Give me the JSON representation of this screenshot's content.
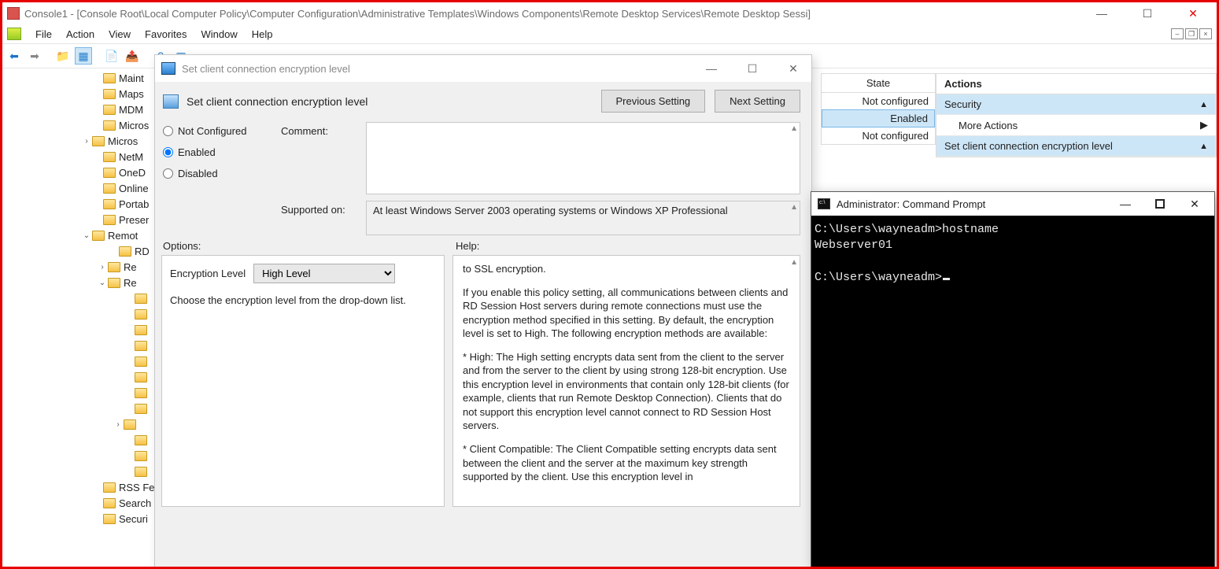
{
  "mmc": {
    "title": "Console1 - [Console Root\\Local Computer Policy\\Computer Configuration\\Administrative Templates\\Windows Components\\Remote Desktop Services\\Remote Desktop Sessi]",
    "menu": {
      "file": "File",
      "action": "Action",
      "view": "View",
      "favorites": "Favorites",
      "window": "Window",
      "help": "Help"
    },
    "tree": [
      {
        "indent": 110,
        "exp": "",
        "label": "Maint"
      },
      {
        "indent": 110,
        "exp": "",
        "label": "Maps"
      },
      {
        "indent": 110,
        "exp": "",
        "label": "MDM"
      },
      {
        "indent": 110,
        "exp": "",
        "label": "Micros"
      },
      {
        "indent": 96,
        "exp": ">",
        "label": "Micros"
      },
      {
        "indent": 110,
        "exp": "",
        "label": "NetM"
      },
      {
        "indent": 110,
        "exp": "",
        "label": "OneD"
      },
      {
        "indent": 110,
        "exp": "",
        "label": "Online"
      },
      {
        "indent": 110,
        "exp": "",
        "label": "Portab"
      },
      {
        "indent": 110,
        "exp": "",
        "label": "Preser"
      },
      {
        "indent": 96,
        "exp": "v",
        "label": "Remot"
      },
      {
        "indent": 130,
        "exp": "",
        "label": "RD"
      },
      {
        "indent": 116,
        "exp": ">",
        "label": "Re"
      },
      {
        "indent": 116,
        "exp": "v",
        "label": "Re"
      },
      {
        "indent": 150,
        "exp": "",
        "label": ""
      },
      {
        "indent": 150,
        "exp": "",
        "label": ""
      },
      {
        "indent": 150,
        "exp": "",
        "label": ""
      },
      {
        "indent": 150,
        "exp": "",
        "label": ""
      },
      {
        "indent": 150,
        "exp": "",
        "label": ""
      },
      {
        "indent": 150,
        "exp": "",
        "label": ""
      },
      {
        "indent": 150,
        "exp": "",
        "label": ""
      },
      {
        "indent": 150,
        "exp": "",
        "label": ""
      },
      {
        "indent": 136,
        "exp": ">",
        "label": ""
      },
      {
        "indent": 150,
        "exp": "",
        "label": ""
      },
      {
        "indent": 150,
        "exp": "",
        "label": ""
      },
      {
        "indent": 150,
        "exp": "",
        "label": ""
      },
      {
        "indent": 110,
        "exp": "",
        "label": "RSS Fe"
      },
      {
        "indent": 110,
        "exp": "",
        "label": "Search"
      },
      {
        "indent": 110,
        "exp": "",
        "label": "Securi"
      }
    ]
  },
  "grid": {
    "header": "State",
    "rows": [
      "Not configured",
      "Enabled",
      "Not configured"
    ],
    "selected_index": 1
  },
  "actions": {
    "header": "Actions",
    "section1": "Security",
    "more": "More Actions",
    "section2": "Set client connection encryption level"
  },
  "dialog": {
    "title": "Set client connection encryption level",
    "header": "Set client connection encryption level",
    "prev": "Previous Setting",
    "next": "Next Setting",
    "radio_nc": "Not Configured",
    "radio_en": "Enabled",
    "radio_di": "Disabled",
    "selected_radio": "Enabled",
    "comment_label": "Comment:",
    "comment_value": "",
    "supported_label": "Supported on:",
    "supported_value": "At least Windows Server 2003 operating systems or Windows XP Professional",
    "options_label": "Options:",
    "help_label": "Help:",
    "enc_level_label": "Encryption Level",
    "enc_level_value": "High Level",
    "enc_level_hint": "Choose the encryption level from the drop-down list.",
    "help_p1": "to SSL encryption.",
    "help_p2": "If you enable this policy setting, all communications between clients and RD Session Host servers during remote connections must use the encryption method specified in this setting. By default, the encryption level is set to High. The following encryption methods are available:",
    "help_p3": "* High: The High setting encrypts data sent from the client to the server and from the server to the client by using strong 128-bit encryption. Use this encryption level in environments that contain only 128-bit clients (for example, clients that run Remote Desktop Connection). Clients that do not support this encryption level cannot connect to RD Session Host servers.",
    "help_p4": "* Client Compatible: The Client Compatible setting encrypts data sent between the client and the server at the maximum key strength supported by the client. Use this encryption level in"
  },
  "cmd": {
    "title": "Administrator: Command Prompt",
    "line1": "C:\\Users\\wayneadm>hostname",
    "line2": "Webserver01",
    "line3": "",
    "line4": "C:\\Users\\wayneadm>"
  }
}
